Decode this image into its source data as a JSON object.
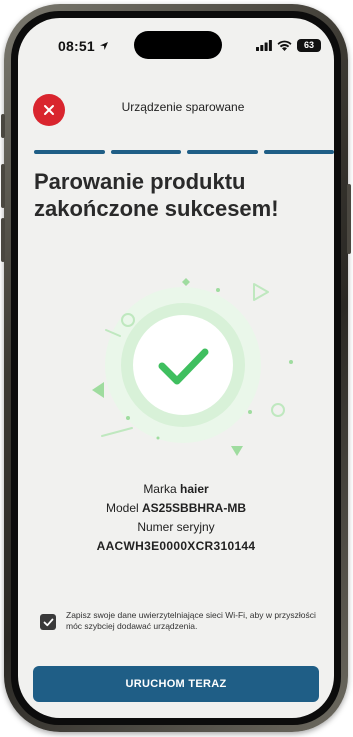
{
  "status_bar": {
    "time": "08:51",
    "battery": "63"
  },
  "header": {
    "title": "Urządzenie sparowane"
  },
  "page": {
    "title": "Parowanie produktu zakończone sukcesem!",
    "progress_steps_total": 4,
    "progress_steps_completed": 4
  },
  "device": {
    "brand_label": "Marka",
    "brand_value": "haier",
    "model_label": "Model",
    "model_value": "AS25SBBHRA-MB",
    "serial_label": "Numer seryjny",
    "serial_value": "AACWH3E0000XCR310144"
  },
  "wifi_option": {
    "checked": true,
    "text": "Zapisz swoje dane uwierzytelniające sieci Wi-Fi, aby w przyszłości móc szybciej dodawać urządzenia."
  },
  "cta": {
    "label": "URUCHOM TERAZ"
  },
  "colors": {
    "accent": "#1f5e86",
    "close": "#d9252e",
    "success": "#3fbf5f",
    "background": "#f1f1ef"
  },
  "icons": {
    "close": "close-icon",
    "success": "checkmark-icon",
    "checkbox": "check-icon",
    "signal": "signal-icon",
    "wifi": "wifi-icon",
    "location": "location-arrow-icon"
  }
}
